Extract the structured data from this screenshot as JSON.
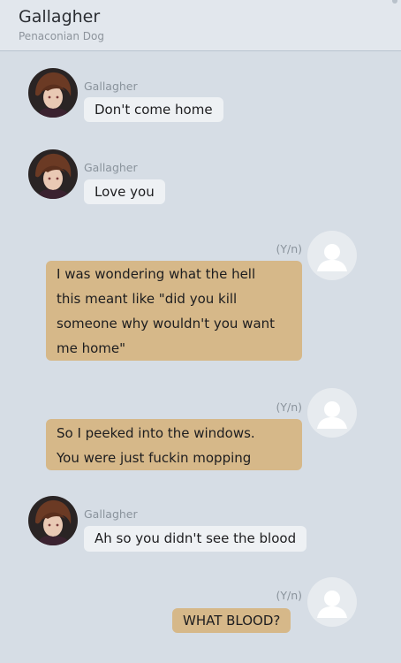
{
  "header": {
    "title": "Gallagher",
    "subtitle": "Penaconian Dog"
  },
  "messages": [
    {
      "sender": "Gallagher",
      "side": "left",
      "lines": [
        "Don't come home"
      ]
    },
    {
      "sender": "Gallagher",
      "side": "left",
      "lines": [
        "Love you"
      ]
    },
    {
      "sender": "(Y/n)",
      "side": "right",
      "lines": [
        "I was wondering what the hell",
        "this meant like \"did you kill",
        "someone  why wouldn't you want",
        "me home\""
      ]
    },
    {
      "sender": "(Y/n)",
      "side": "right",
      "lines": [
        "So I peeked into the windows.",
        "You were just fuckin mopping"
      ]
    },
    {
      "sender": "Gallagher",
      "side": "left",
      "lines": [
        "Ah so you didn't see the blood"
      ]
    },
    {
      "sender": "(Y/n)",
      "side": "right",
      "lines": [
        "WHAT BLOOD?"
      ]
    }
  ],
  "colors": {
    "background": "#d6dde5",
    "incoming_bubble": "#eef1f4",
    "outgoing_bubble": "#d6b889"
  },
  "icons": {
    "left_avatar": "gallagher-avatar",
    "right_avatar": "default-user-avatar-icon"
  }
}
